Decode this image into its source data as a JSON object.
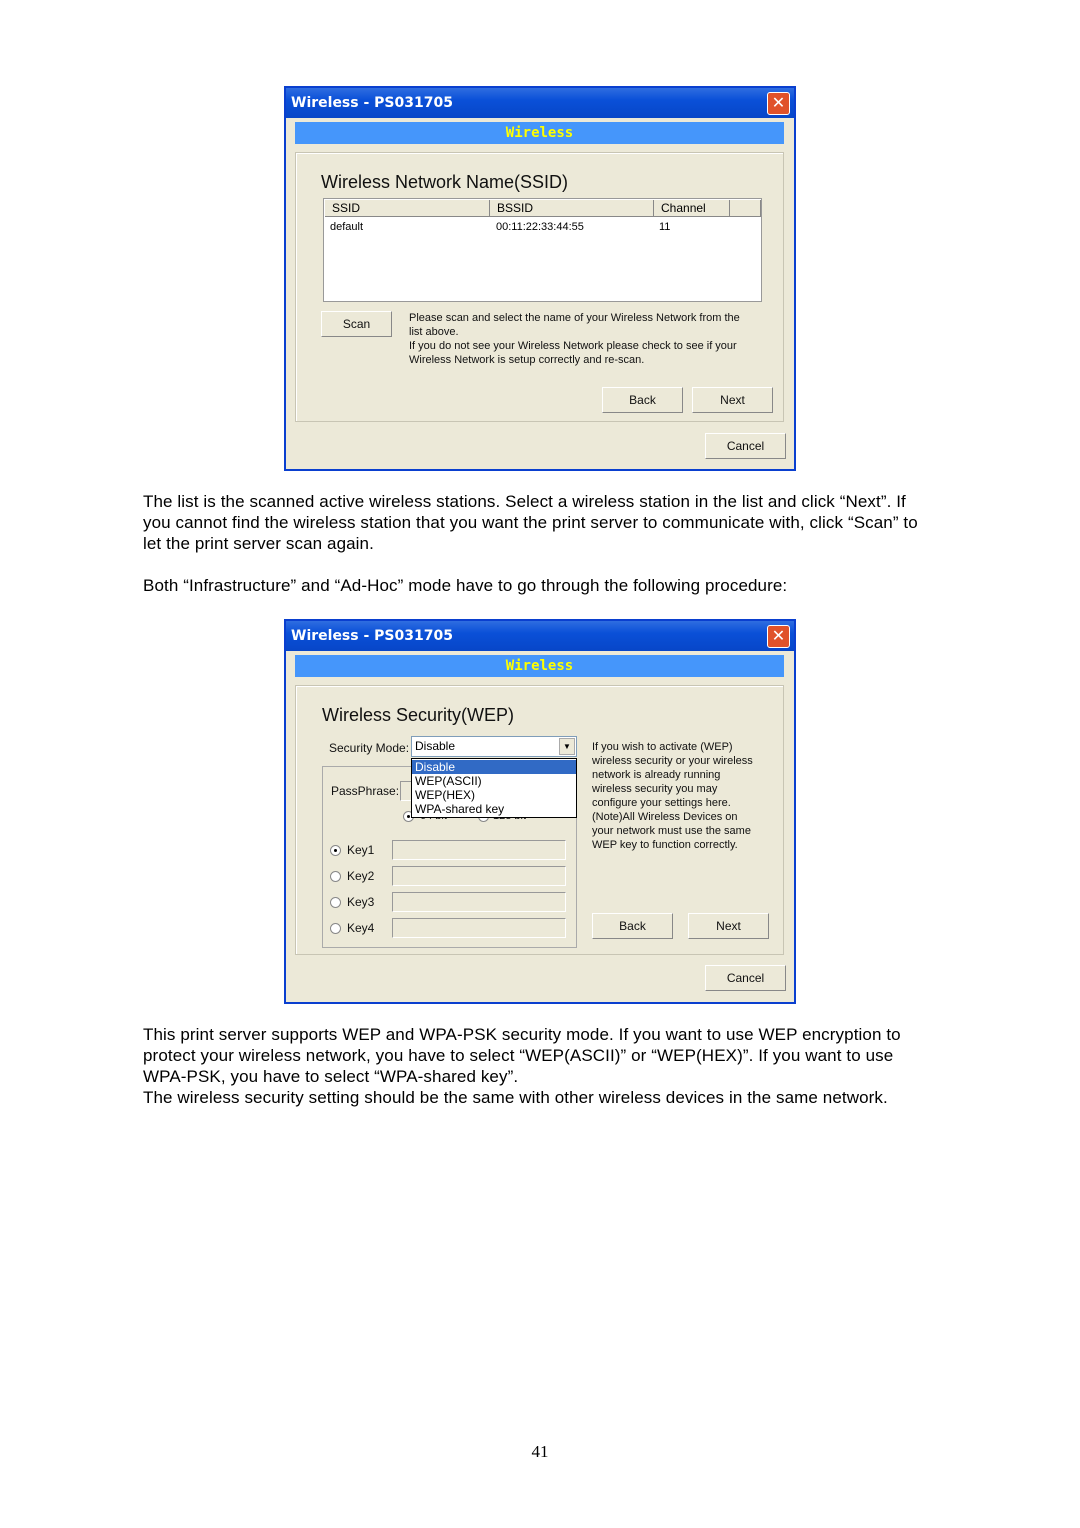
{
  "dialog1": {
    "window_title": "Wireless - PS031705",
    "banner": "Wireless",
    "heading": "Wireless Network Name(SSID)",
    "columns": [
      "SSID",
      "BSSID",
      "Channel"
    ],
    "rows": [
      {
        "ssid": "default",
        "bssid": "00:11:22:33:44:55",
        "channel": "11"
      }
    ],
    "scan": "Scan",
    "help": [
      "Please scan and select the name of your Wireless Network from the",
      "list above.",
      "If you do not see your Wireless Network please check to see if your",
      "Wireless Network is setup correctly and re-scan."
    ],
    "back": "Back",
    "next": "Next",
    "cancel": "Cancel"
  },
  "paragraph1": [
    "The list is the scanned active wireless stations. Select a wireless station in the list and click “Next”. If",
    "you cannot find the wireless station that you want the print server to communicate with, click “Scan” to",
    "let the print server scan again."
  ],
  "paragraph2": "Both “Infrastructure” and “Ad-Hoc” mode have to go through the following procedure:",
  "dialog2": {
    "window_title": "Wireless - PS031705",
    "banner": "Wireless",
    "heading": "Wireless Security(WEP)",
    "security_mode_label": "Security Mode:",
    "security_mode_value": "Disable",
    "options": [
      "Disable",
      "WEP(ASCII)",
      "WEP(HEX)",
      "WPA-shared key"
    ],
    "passphrase_label": "PassPhrase:",
    "bit64": "64 bit",
    "bit128": "128 bit",
    "keys": [
      "Key1",
      "Key2",
      "Key3",
      "Key4"
    ],
    "selected_key": "Key1",
    "help": [
      "If you wish to activate (WEP)",
      "wireless security or your wireless",
      "network is already running",
      "wireless security you may",
      "configure your settings here.",
      "(Note)All Wireless Devices on",
      "your network must use the same",
      "WEP key to function correctly."
    ],
    "back": "Back",
    "next": "Next",
    "cancel": "Cancel"
  },
  "paragraph3": [
    "This print server supports WEP and WPA-PSK security mode. If you want to use WEP encryption to",
    "protect your wireless network, you have to select “WEP(ASCII)” or “WEP(HEX)”. If you want to use",
    "WPA-PSK, you have to select “WPA-shared key”.",
    "The wireless security setting should be the same with other wireless devices in the same network."
  ],
  "page_number": "41"
}
